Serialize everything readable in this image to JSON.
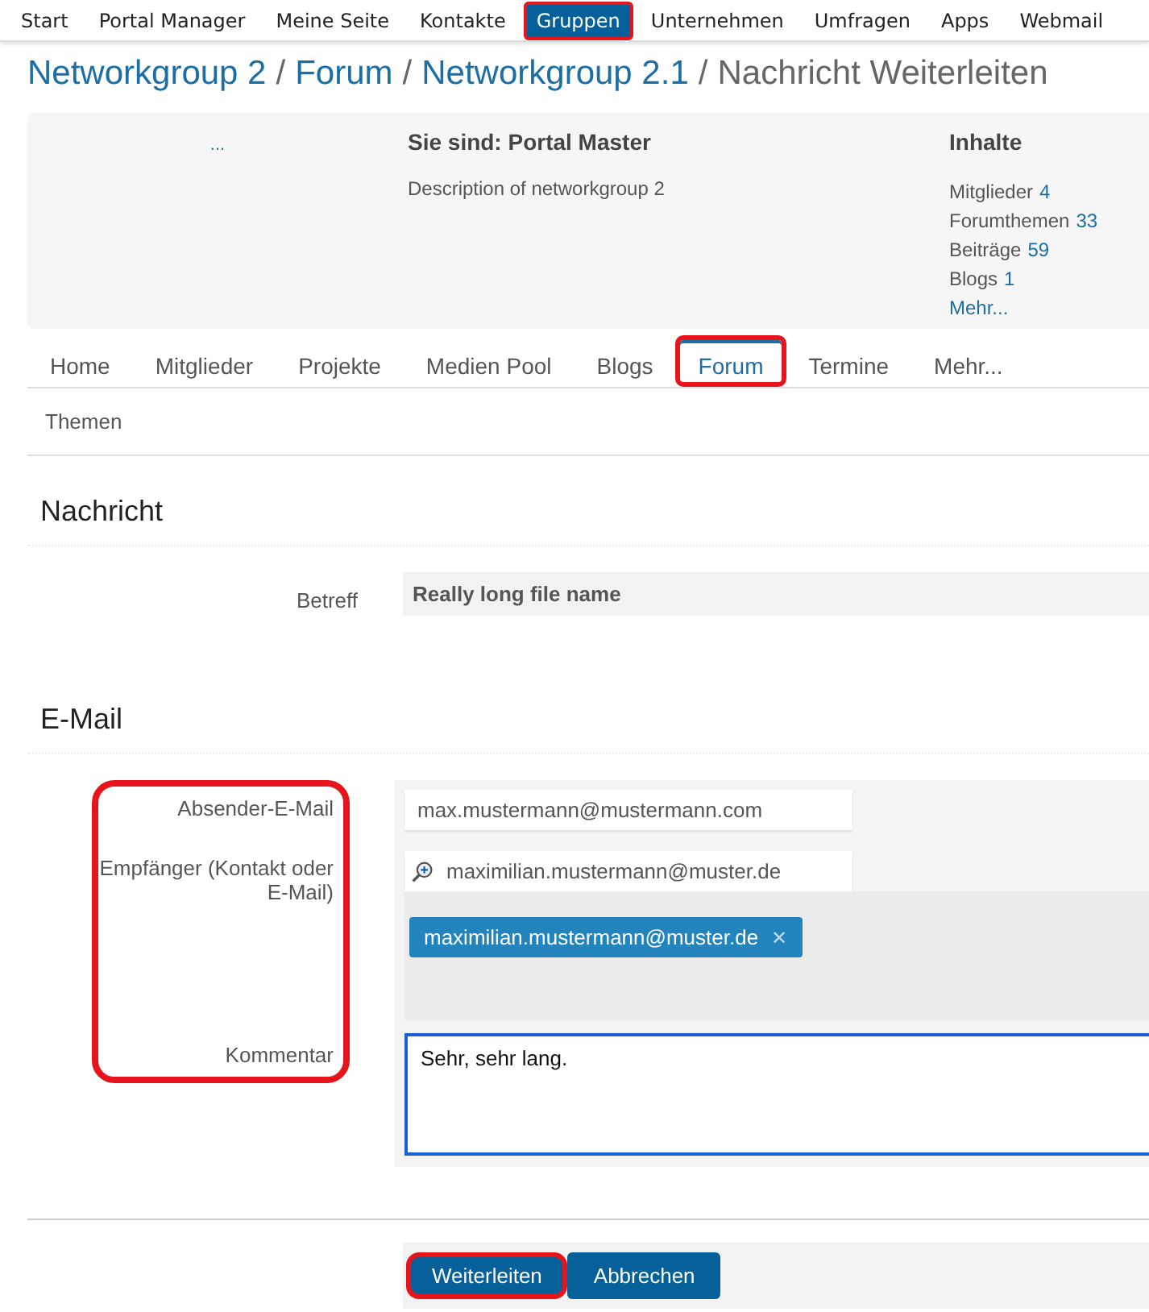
{
  "top_nav": [
    {
      "label": "Start",
      "selected": false,
      "highlighted": false
    },
    {
      "label": "Portal Manager",
      "selected": false,
      "highlighted": false
    },
    {
      "label": "Meine Seite",
      "selected": false,
      "highlighted": false
    },
    {
      "label": "Kontakte",
      "selected": false,
      "highlighted": false
    },
    {
      "label": "Gruppen",
      "selected": true,
      "highlighted": true
    },
    {
      "label": "Unternehmen",
      "selected": false,
      "highlighted": false
    },
    {
      "label": "Umfragen",
      "selected": false,
      "highlighted": false
    },
    {
      "label": "Apps",
      "selected": false,
      "highlighted": false
    },
    {
      "label": "Webmail",
      "selected": false,
      "highlighted": false
    }
  ],
  "breadcrumb": [
    {
      "label": "Networkgroup 2",
      "kind": "link"
    },
    {
      "label": "Forum",
      "kind": "link"
    },
    {
      "label": "Networkgroup 2.1",
      "kind": "link"
    },
    {
      "label": "Nachricht Weiterleiten",
      "kind": "current"
    }
  ],
  "breadcrumb_separator": "/",
  "group_header": {
    "logo_link": "...",
    "role_title": "Sie sind: Portal Master",
    "description": "Description of networkgroup 2",
    "contents_title": "Inhalte",
    "stats": [
      {
        "label": "Mitglieder",
        "value": "4"
      },
      {
        "label": "Forumthemen",
        "value": "33"
      },
      {
        "label": "Beiträge",
        "value": "59"
      },
      {
        "label": "Blogs",
        "value": "1"
      }
    ],
    "more_link": "Mehr..."
  },
  "tabs": [
    {
      "label": "Home",
      "selected": false,
      "highlighted": false
    },
    {
      "label": "Mitglieder",
      "selected": false,
      "highlighted": false
    },
    {
      "label": "Projekte",
      "selected": false,
      "highlighted": false
    },
    {
      "label": "Medien Pool",
      "selected": false,
      "highlighted": false
    },
    {
      "label": "Blogs",
      "selected": false,
      "highlighted": false
    },
    {
      "label": "Forum",
      "selected": true,
      "highlighted": true
    },
    {
      "label": "Termine",
      "selected": false,
      "highlighted": false
    },
    {
      "label": "Mehr...",
      "selected": false,
      "highlighted": false
    }
  ],
  "subtabs": [
    {
      "label": "Themen",
      "selected": false
    }
  ],
  "message_section": {
    "title": "Nachricht",
    "subject_label": "Betreff",
    "subject_value": "Really long file name"
  },
  "email_section": {
    "title": "E-Mail",
    "labels_highlighted": true,
    "sender_label": "Absender-E-Mail",
    "sender_value": "max.mustermann@mustermann.com",
    "recipient_label": "Empfänger (Kontakt oder E-Mail)",
    "recipient_value": "maximilian.mustermann@muster.de",
    "recipients": [
      {
        "label": "maximilian.mustermann@muster.de",
        "remove": "✕"
      }
    ],
    "comment_label": "Kommentar",
    "comment_value": "Sehr, sehr lang.",
    "comment_focused": true
  },
  "buttons": [
    {
      "label": "Weiterleiten",
      "highlighted": true
    },
    {
      "label": "Abbrechen",
      "highlighted": false
    }
  ]
}
